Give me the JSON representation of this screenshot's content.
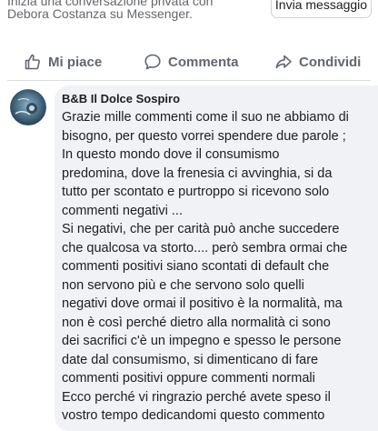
{
  "header": {
    "line1": "Inizia una conversazione privata con",
    "line2": "Debora Costanza su Messenger.",
    "message_button": "Invia messaggio"
  },
  "actions": {
    "like": "Mi piace",
    "comment": "Commenta",
    "share": "Condividi"
  },
  "comment": {
    "author": "B&B Il Dolce Sospiro",
    "lines": [
      "Grazie mille commenti come il suo ne abbiamo di",
      "bisogno, per questo vorrei spendere due parole ;",
      "In questo mondo dove il consumismo",
      "predomina, dove la frenesia ci avvinghia, si da",
      "tutto per scontato e purtroppo si ricevono solo",
      "commenti negativi ...",
      "Si negativi, che per carità può anche succedere",
      "che qualcosa va storto.... però sembra ormai che",
      "commenti positivi siano scontati di default che",
      "non servono più e che servono solo quelli",
      "negativi dove ormai il positivo è la normalità, ma",
      "non è così perché dietro alla normalità ci sono",
      "dei sacrifici c'è un impegno e spesso le persone",
      "date dal consumismo, si dimenticano di fare",
      "commenti positivi oppure commenti normali",
      "Ecco perché vi ringrazio perché avete speso il",
      "vostro tempo dedicandomi questo commento"
    ]
  },
  "colors": {
    "bubble": "#f0f2f5",
    "secondary_text": "#65676b",
    "action_text": "#606770"
  }
}
